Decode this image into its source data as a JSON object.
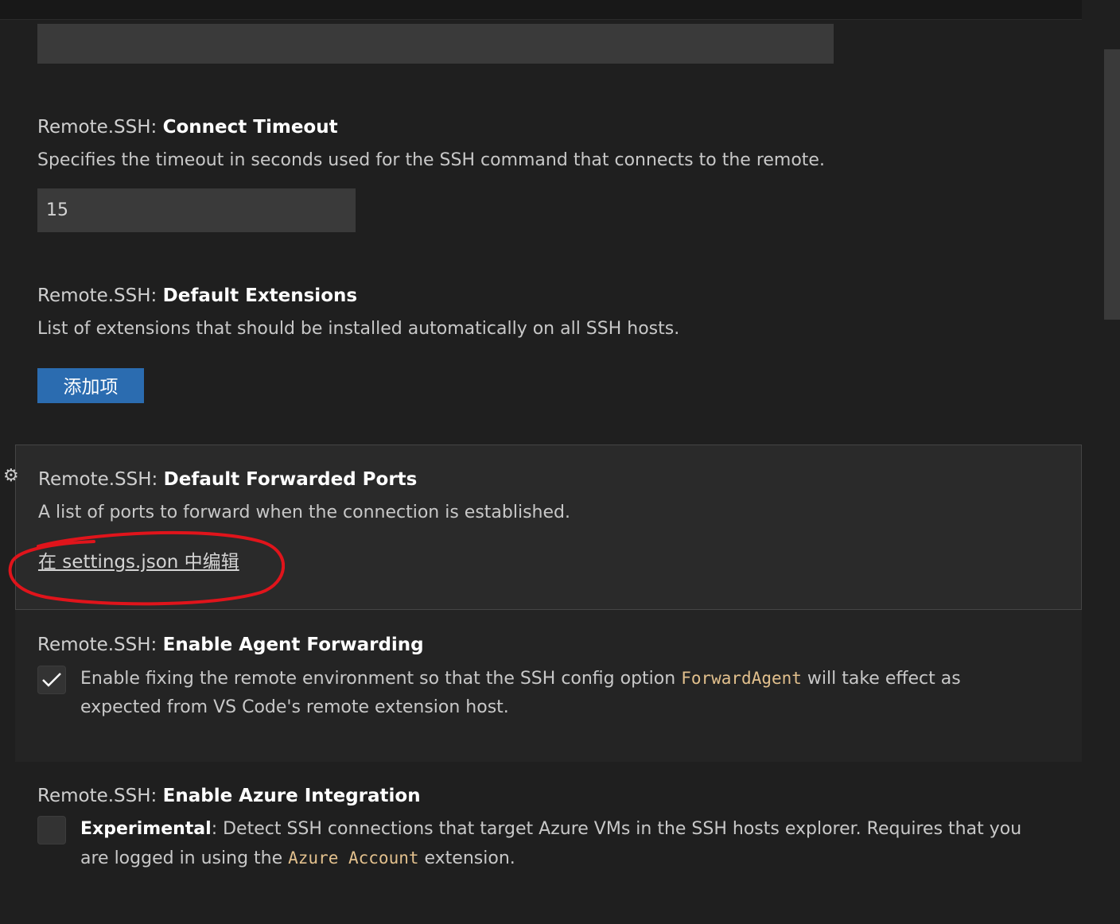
{
  "settings": {
    "connect_timeout": {
      "category": "Remote.SSH:",
      "name": "Connect Timeout",
      "description": "Specifies the timeout in seconds used for the SSH command that connects to the remote.",
      "value": "15"
    },
    "default_extensions": {
      "category": "Remote.SSH:",
      "name": "Default Extensions",
      "description": "List of extensions that should be installed automatically on all SSH hosts.",
      "add_button": "添加项"
    },
    "default_forwarded_ports": {
      "category": "Remote.SSH:",
      "name": "Default Forwarded Ports",
      "description": "A list of ports to forward when the connection is established.",
      "edit_link": "在 settings.json 中编辑",
      "annotation_color": "#e0141b"
    },
    "enable_agent_forwarding": {
      "category": "Remote.SSH:",
      "name": "Enable Agent Forwarding",
      "checked": true,
      "desc_before": "Enable fixing the remote environment so that the SSH config option ",
      "desc_code": "ForwardAgent",
      "desc_after": " will take effect as expected from VS Code's remote extension host."
    },
    "enable_azure_integration": {
      "category": "Remote.SSH:",
      "name": "Enable Azure Integration",
      "checked": false,
      "desc_bold": "Experimental",
      "desc_middle": ": Detect SSH connections that target Azure VMs in the SSH hosts explorer. Requires that you are logged in using the ",
      "desc_code": "Azure Account",
      "desc_after": " extension."
    }
  },
  "colors": {
    "background": "#1f1f1f",
    "button": "#2b6cb0",
    "code": "#e2c08d"
  }
}
